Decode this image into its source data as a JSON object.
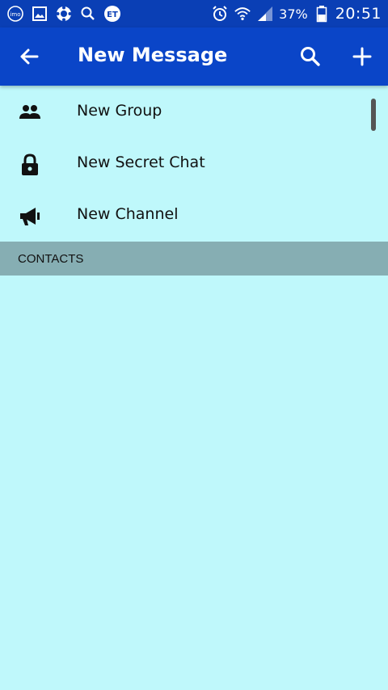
{
  "status_bar": {
    "left_icons": [
      "imo-icon",
      "gallery-icon",
      "settings-badge-icon",
      "search-icon",
      "et-icon"
    ],
    "right_icons": [
      "alarm-icon",
      "wifi-icon",
      "signal-icon",
      "battery-icon"
    ],
    "battery": "37%",
    "time": "20:51"
  },
  "app_bar": {
    "title": "New Message",
    "back_icon": "arrow-left-icon",
    "search_icon": "search-icon",
    "add_icon": "plus-icon"
  },
  "menu": [
    {
      "label": "New Group",
      "icon": "group-icon"
    },
    {
      "label": "New Secret Chat",
      "icon": "lock-icon"
    },
    {
      "label": "New Channel",
      "icon": "megaphone-icon"
    }
  ],
  "section": {
    "label": "CONTACTS"
  },
  "colors": {
    "status_bar": "#0a3fb5",
    "app_bar": "#0a45c8",
    "background": "#bff8fb",
    "section_header": "#86aeb3"
  }
}
